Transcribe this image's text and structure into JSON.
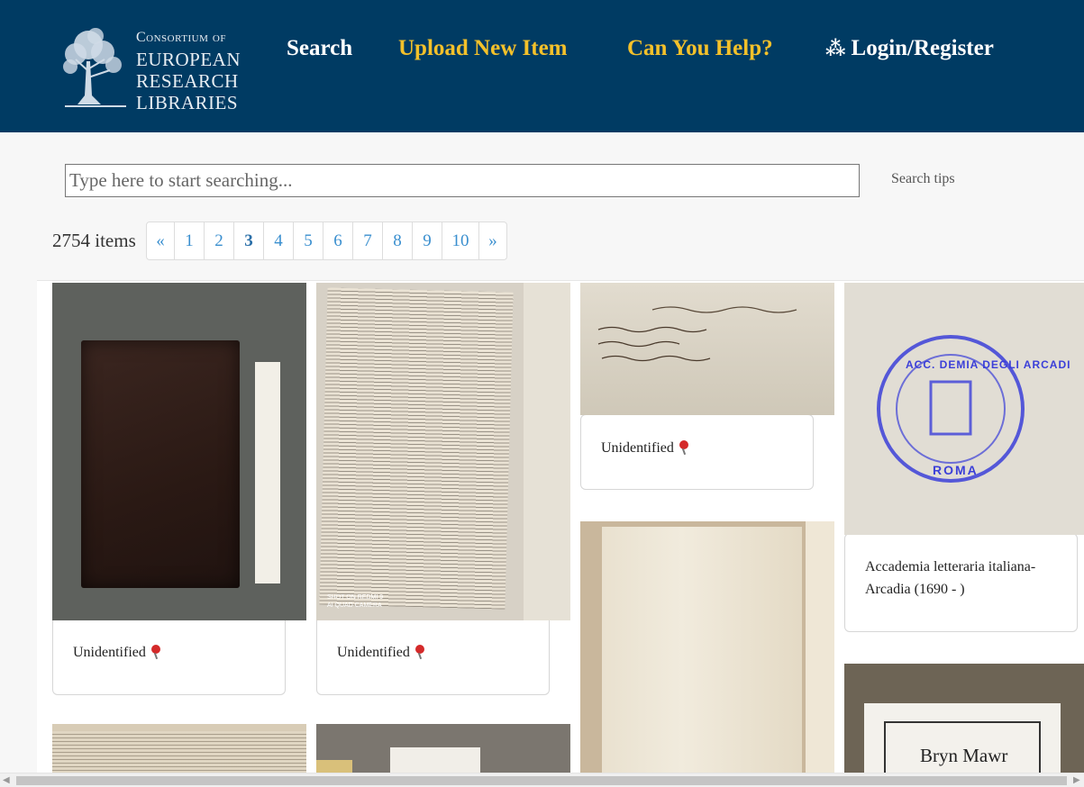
{
  "header": {
    "logo": {
      "line1": "Consortium of",
      "line2": "EUROPEAN",
      "line3": "RESEARCH",
      "line4": "LIBRARIES"
    },
    "nav": {
      "search": "Search",
      "upload": "Upload New Item",
      "help": "Can You Help?",
      "login": "Login/Register",
      "login_icon": "people-icon"
    },
    "colors": {
      "background": "#003b63",
      "accent": "#f4c12a"
    }
  },
  "search": {
    "placeholder": "Type here to start searching...",
    "value": "",
    "tips_label": "Search tips"
  },
  "results": {
    "count_label": "2754 items",
    "pagination": {
      "prev": "«",
      "next": "»",
      "pages": [
        "1",
        "2",
        "3",
        "4",
        "5",
        "6",
        "7",
        "8",
        "9",
        "10"
      ],
      "current": "3"
    }
  },
  "items": [
    {
      "label": "Unidentified",
      "image": "dark leather-bound book with paper slip"
    },
    {
      "label": "Unidentified",
      "image": "printed page with handwritten marginalia",
      "overlay_line1": "SHOT ON REDMI 9",
      "overlay_line2": "AI QUAD CAMERA"
    },
    {
      "label": "Unidentified",
      "image": "handwritten inscription on endpaper"
    },
    {
      "label": "Accademia letteraria italiana-Arcadia (1690 - )",
      "image": "blue circular stamp",
      "stamp_text": "ACC. DEMIA DEGLI ARCADI",
      "stamp_city": "ROMA"
    },
    {
      "label": "",
      "image": "open book page with stains"
    },
    {
      "label": "",
      "image": "bookplate",
      "plate_text": "Bryn Mawr"
    },
    {
      "label": "",
      "image": "printed page partial"
    },
    {
      "label": "",
      "image": "book with label partial"
    }
  ]
}
